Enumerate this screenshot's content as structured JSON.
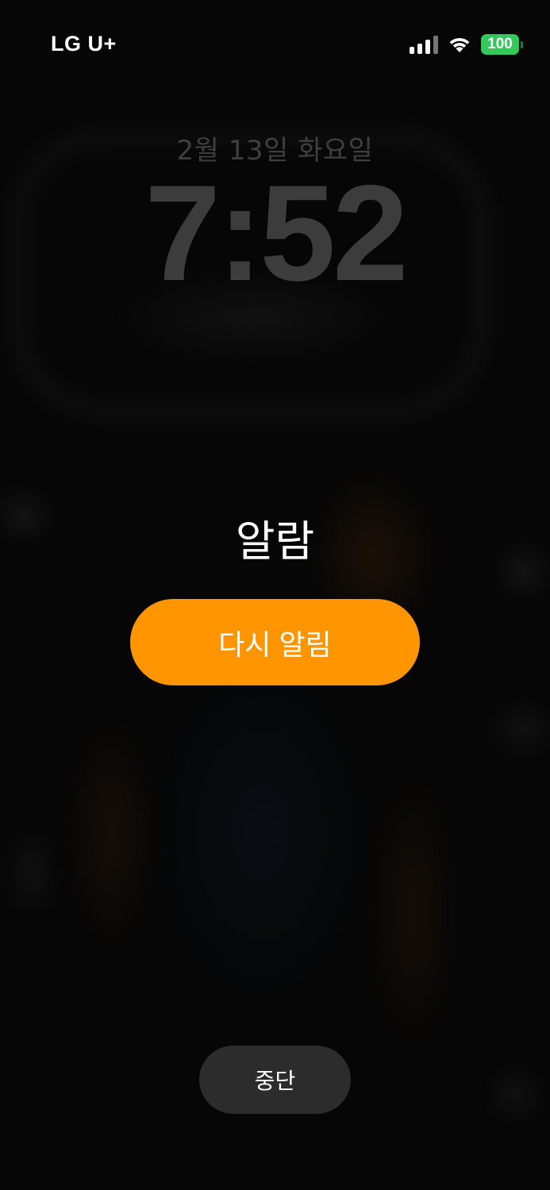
{
  "status_bar": {
    "carrier": "LG U+",
    "signal_icon": "cellular-signal-icon",
    "wifi_icon": "wifi-icon",
    "battery_level": "100",
    "battery_color": "#34c759"
  },
  "lock_screen": {
    "date": "2월 13일 화요일",
    "time": "7:52"
  },
  "alarm": {
    "title": "알람",
    "snooze_label": "다시 알림",
    "snooze_color": "#ff9500",
    "stop_label": "중단"
  }
}
